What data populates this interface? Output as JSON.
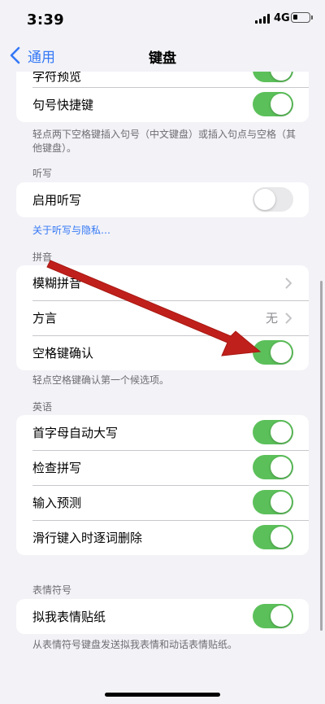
{
  "status": {
    "time": "3:39",
    "network": "4G"
  },
  "nav": {
    "back_label": "通用",
    "title": "键盘"
  },
  "top_card": {
    "partial_row": {
      "label": "字符预览",
      "on": true
    },
    "period_shortcut": {
      "label": "句号快捷键",
      "on": true
    }
  },
  "top_footer": "轻点两下空格键插入句号（中文键盘）或插入句点与空格（其他键盘）。",
  "dictation": {
    "header": "听写",
    "enable": {
      "label": "启用听写",
      "on": false
    },
    "privacy_link": "关于听写与隐私…"
  },
  "pinyin": {
    "header": "拼音",
    "fuzzy": {
      "label": "模糊拼音"
    },
    "dialect": {
      "label": "方言",
      "value": "无"
    },
    "space_confirm": {
      "label": "空格键确认",
      "on": true
    },
    "footer": "轻点空格键确认第一个候选项。"
  },
  "english": {
    "header": "英语",
    "items": [
      {
        "label": "首字母自动大写",
        "on": true
      },
      {
        "label": "检查拼写",
        "on": true
      },
      {
        "label": "输入预测",
        "on": true
      },
      {
        "label": "滑行键入时逐词删除",
        "on": true
      }
    ]
  },
  "emoji": {
    "header": "表情符号",
    "memoji": {
      "label": "拟我表情贴纸",
      "on": true
    },
    "footer": "从表情符号键盘发送拟我表情和动话表情贴纸。"
  },
  "colors": {
    "accent": "#3478f6",
    "toggle_on": "#5cc05a",
    "annotation": "#c0201b"
  }
}
